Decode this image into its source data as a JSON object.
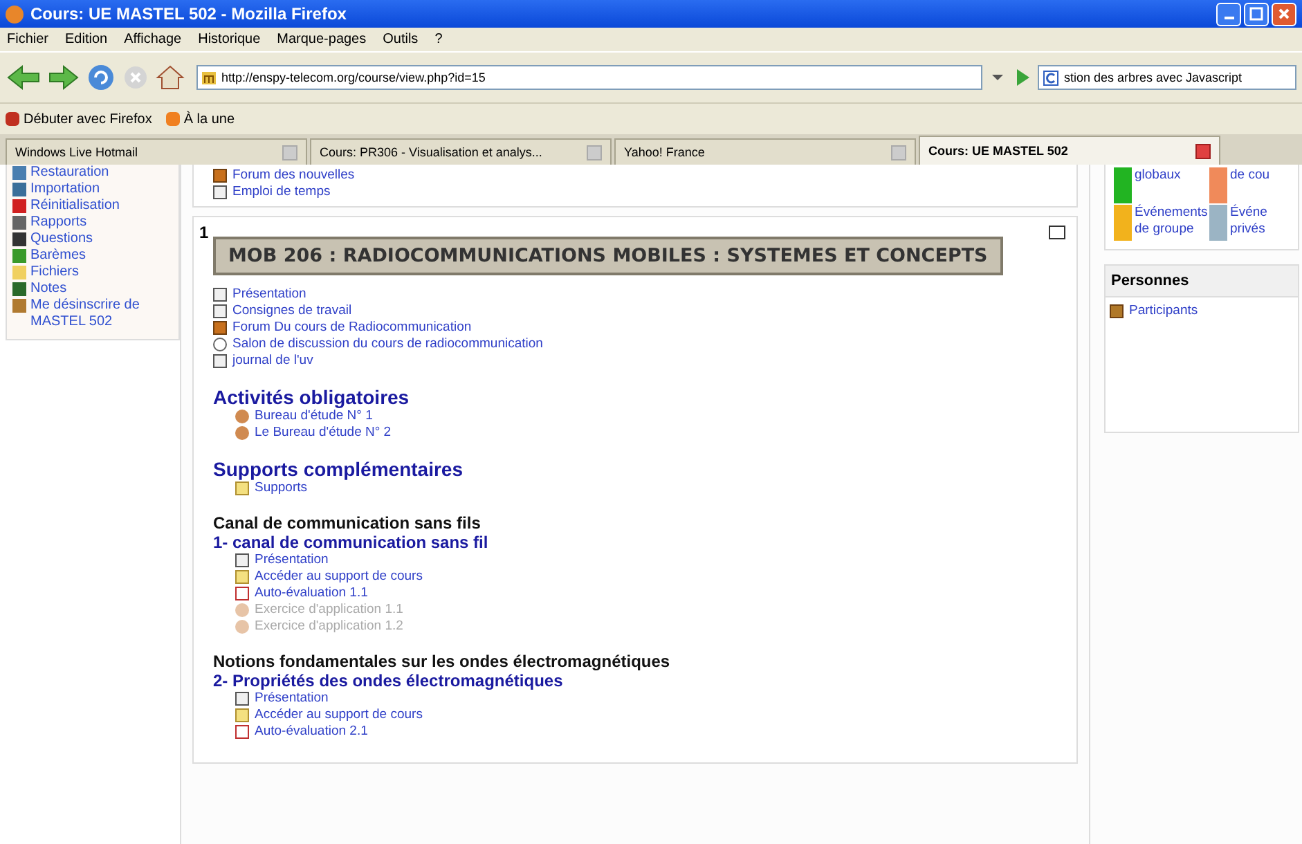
{
  "window": {
    "title": "Cours: UE MASTEL 502 - Mozilla Firefox"
  },
  "menu": [
    "Fichier",
    "Edition",
    "Affichage",
    "Historique",
    "Marque-pages",
    "Outils",
    "?"
  ],
  "toolbar": {
    "url": "http://enspy-telecom.org/course/view.php?id=15",
    "search": "stion des arbres avec Javascript"
  },
  "bookmarks": [
    {
      "label": "Débuter avec Firefox",
      "kind": "firefox"
    },
    {
      "label": "À la une",
      "kind": "feed"
    }
  ],
  "tabs": [
    {
      "label": "Windows Live Hotmail",
      "selected": false
    },
    {
      "label": "Cours: PR306 - Visualisation et analys...",
      "selected": false
    },
    {
      "label": "Yahoo! France",
      "selected": false
    },
    {
      "label": "Cours: UE MASTEL 502",
      "selected": true
    }
  ],
  "sidebar": {
    "items": [
      {
        "label": "Restauration",
        "kind": "restore"
      },
      {
        "label": "Importation",
        "kind": "import"
      },
      {
        "label": "Réinitialisation",
        "kind": "reset"
      },
      {
        "label": "Rapports",
        "kind": "report"
      },
      {
        "label": "Questions",
        "kind": "questions"
      },
      {
        "label": "Barèmes",
        "kind": "scales"
      },
      {
        "label": "Fichiers",
        "kind": "folder"
      },
      {
        "label": "Notes",
        "kind": "grades"
      },
      {
        "label": "Me désinscrire de MASTEL 502",
        "kind": "unenrol"
      }
    ]
  },
  "top_items": [
    {
      "label": "Forum des nouvelles",
      "kind": "forum"
    },
    {
      "label": "Emploi de temps",
      "kind": "journal"
    }
  ],
  "section": {
    "number": "1",
    "title": "MOB 206 : RADIOCOMMUNICATIONS MOBILES : SYSTEMES ET CONCEPTS",
    "blocks": [
      {
        "kind": "list",
        "items": [
          {
            "label": "Présentation",
            "kind": "page",
            "disabled": false
          },
          {
            "label": "Consignes de travail",
            "kind": "page",
            "disabled": false
          },
          {
            "label": "Forum Du cours de Radiocommunication",
            "kind": "forum",
            "disabled": false
          },
          {
            "label": "Salon de discussion du cours de radiocommunication",
            "kind": "chat",
            "disabled": false
          },
          {
            "label": "journal de l'uv",
            "kind": "journal",
            "disabled": false
          }
        ]
      },
      {
        "kind": "heading",
        "text": "Activités obligatoires",
        "items": [
          {
            "label": "Bureau d'étude N° 1",
            "kind": "workshop",
            "disabled": false
          },
          {
            "label": "Le Bureau d'étude N° 2",
            "kind": "workshop",
            "disabled": false
          }
        ]
      },
      {
        "kind": "heading",
        "text": "Supports complémentaires",
        "items": [
          {
            "label": "Supports",
            "kind": "folder",
            "disabled": false
          }
        ]
      },
      {
        "kind": "topic",
        "text": "Canal de communication sans fils"
      },
      {
        "kind": "subtopic",
        "text": "1- canal de communication sans fil",
        "items": [
          {
            "label": "Présentation",
            "kind": "page",
            "disabled": false
          },
          {
            "label": "Accéder au support de cours",
            "kind": "folder",
            "disabled": false
          },
          {
            "label": "Auto-évaluation 1.1",
            "kind": "quiz",
            "disabled": false
          },
          {
            "label": "Exercice d'application 1.1",
            "kind": "workshop",
            "disabled": true
          },
          {
            "label": "Exercice d'application 1.2",
            "kind": "workshop",
            "disabled": true
          }
        ]
      },
      {
        "kind": "topic",
        "text": "Notions fondamentales sur les ondes électromagnétiques"
      },
      {
        "kind": "subtopic",
        "text": "2- Propriétés des ondes électromagnétiques",
        "items": [
          {
            "label": "Présentation",
            "kind": "page",
            "disabled": false
          },
          {
            "label": "Accéder au support de cours",
            "kind": "folder",
            "disabled": false
          },
          {
            "label": "Auto-évaluation 2.1",
            "kind": "quiz",
            "disabled": false
          }
        ]
      }
    ]
  },
  "events": [
    {
      "label": "globaux",
      "color": "#22b422"
    },
    {
      "label": "de cou",
      "color": "#f08a5a"
    },
    {
      "label": "Événements de groupe",
      "color": "#f2b21c"
    },
    {
      "label": "Événe privés",
      "color": "#9bb4c4"
    }
  ],
  "people": {
    "title": "Personnes",
    "items": [
      {
        "label": "Participants"
      }
    ]
  }
}
